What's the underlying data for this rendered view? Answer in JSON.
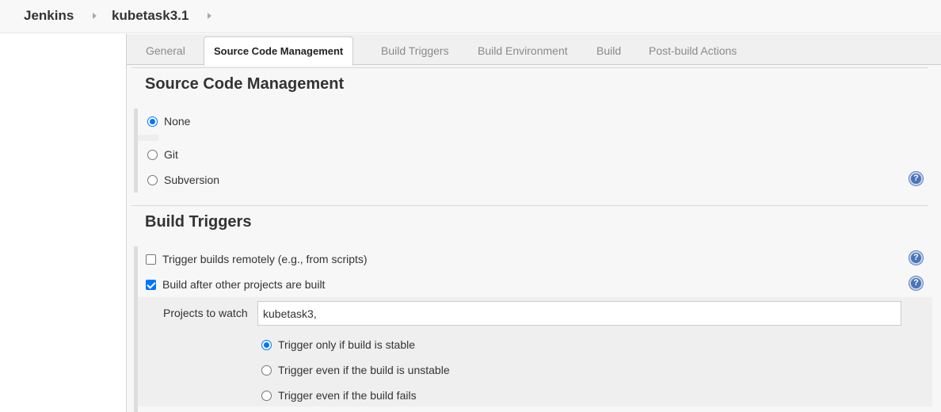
{
  "breadcrumb": {
    "root": "Jenkins",
    "job": "kubetask3.1"
  },
  "tabs": [
    {
      "label": "General",
      "active": false
    },
    {
      "label": "Source Code Management",
      "active": true
    },
    {
      "label": "Build Triggers",
      "active": false
    },
    {
      "label": "Build Environment",
      "active": false
    },
    {
      "label": "Build",
      "active": false
    },
    {
      "label": "Post-build Actions",
      "active": false
    }
  ],
  "scm": {
    "title": "Source Code Management",
    "options": [
      {
        "label": "None",
        "checked": true
      },
      {
        "label": "Git",
        "checked": false
      },
      {
        "label": "Subversion",
        "checked": false
      }
    ]
  },
  "triggers": {
    "title": "Build Triggers",
    "remote_label": "Trigger builds remotely (e.g., from scripts)",
    "remote_checked": false,
    "after_label": "Build after other projects are built",
    "after_checked": true,
    "projects_label": "Projects to watch",
    "projects_value": "kubetask3,",
    "conditions": [
      {
        "label": "Trigger only if build is stable",
        "checked": true
      },
      {
        "label": "Trigger even if the build is unstable",
        "checked": false
      },
      {
        "label": "Trigger even if the build fails",
        "checked": false
      }
    ]
  },
  "icons": {
    "help": "help-icon",
    "separator": "chevron-right-icon"
  },
  "colors": {
    "accent": "#0075ff",
    "help": "#4a74b9"
  }
}
